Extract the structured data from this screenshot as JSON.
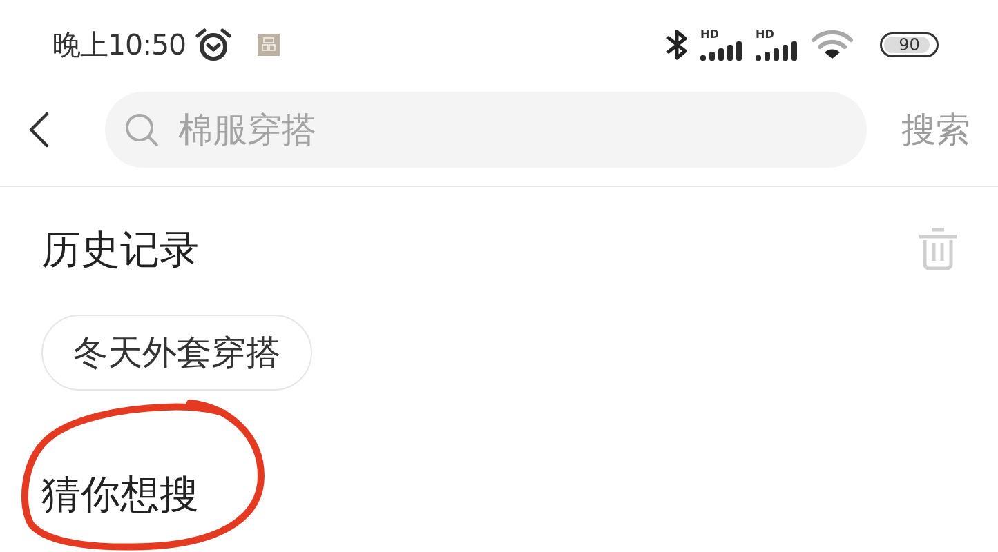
{
  "status_bar": {
    "time": "晚上10:50",
    "signals": [
      {
        "label": "HD"
      },
      {
        "label": "HD"
      }
    ],
    "battery": {
      "text": "90",
      "level": 0.9
    }
  },
  "search_bar": {
    "placeholder": "棉服穿搭",
    "button": "搜索"
  },
  "history": {
    "title": "历史记录",
    "items": [
      "冬天外套穿搭"
    ]
  },
  "suggestions": {
    "title": "猜你想搜",
    "circled": true
  }
}
